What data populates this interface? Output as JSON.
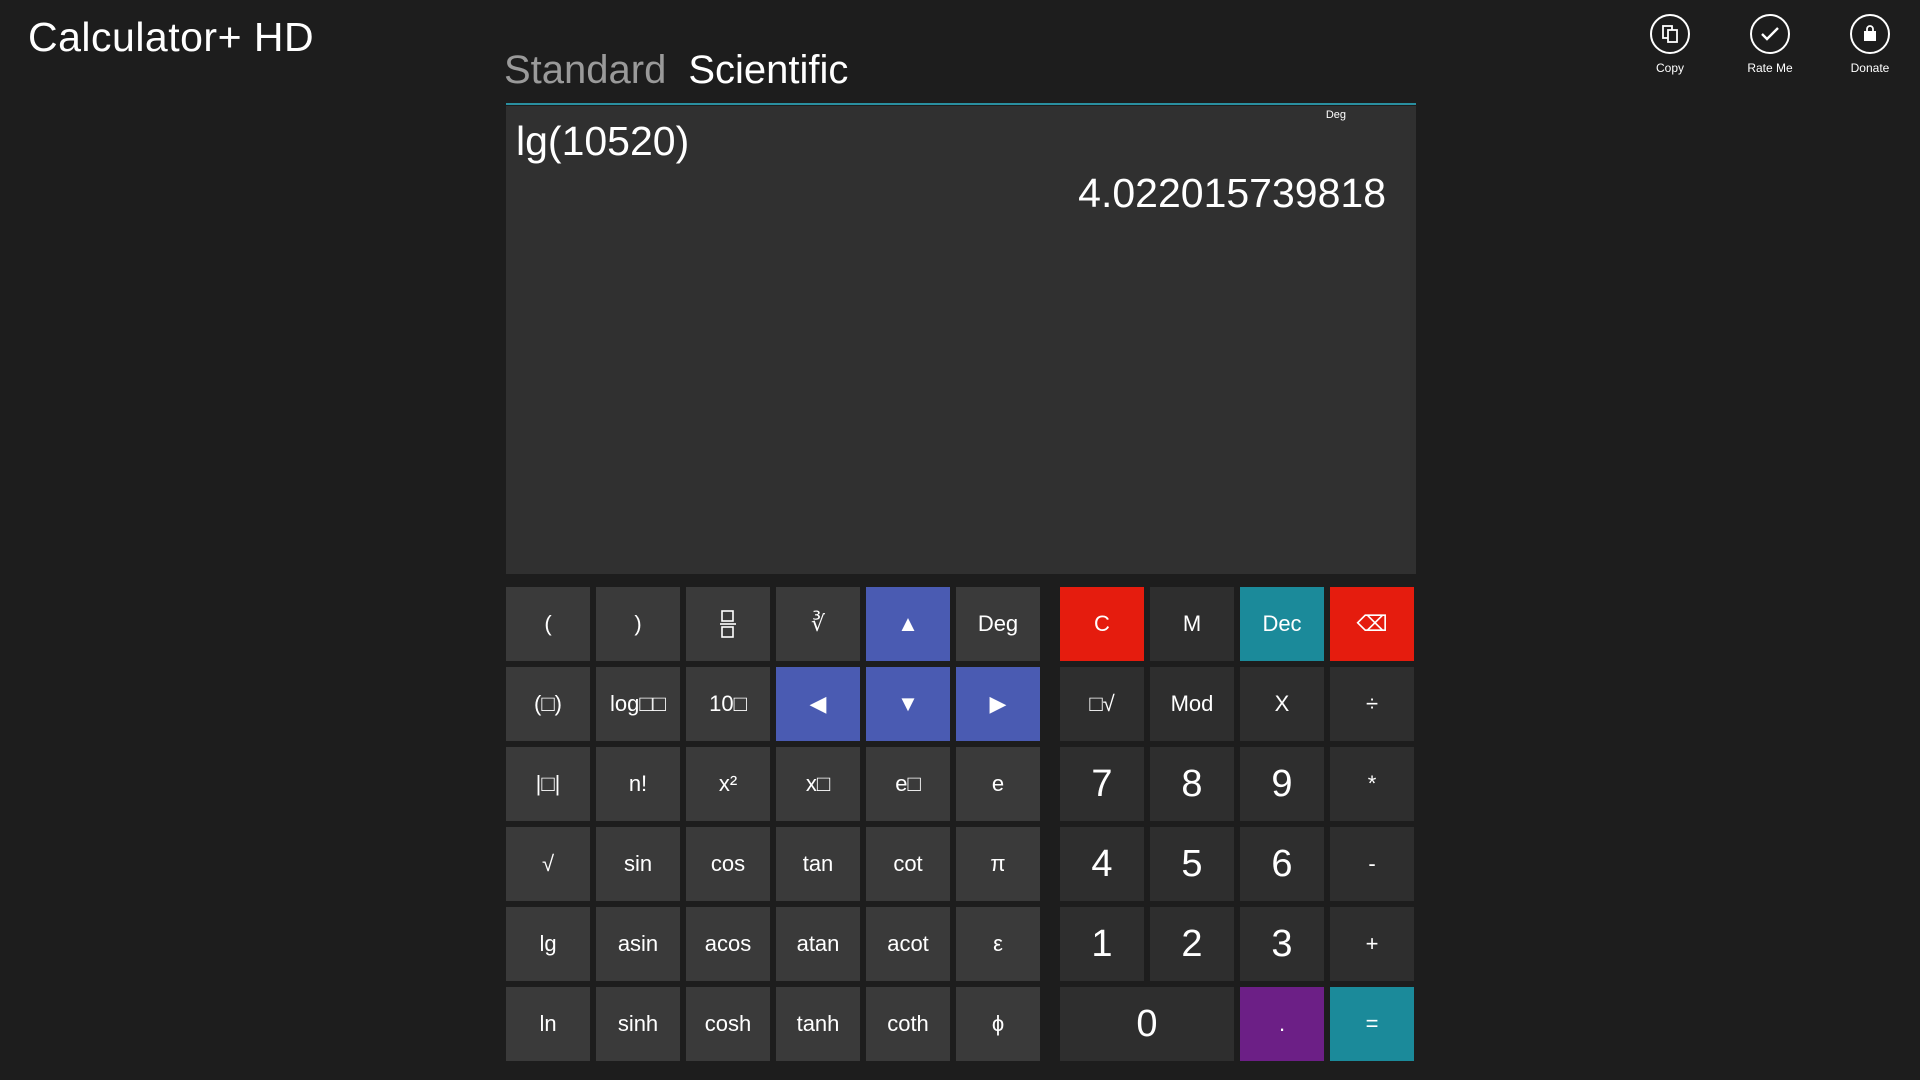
{
  "app": {
    "title": "Calculator+ HD"
  },
  "tabs": [
    {
      "label": "Standard",
      "active": false
    },
    {
      "label": "Scientific",
      "active": true
    }
  ],
  "appbar": {
    "copy_label": "Copy",
    "rate_label": "Rate Me",
    "donate_label": "Donate"
  },
  "display": {
    "angle_mode": "Deg",
    "expression": "lg(10520)",
    "result": "4.022015739818"
  },
  "keypad": {
    "scientific": {
      "row1": [
        "(",
        ")",
        "□/□",
        "∛",
        "▲",
        "Deg"
      ],
      "row2": [
        "(□)",
        "log□□",
        "10□",
        "◀",
        "▼",
        "▶"
      ],
      "row3": [
        "|□|",
        "n!",
        "x²",
        "x□",
        "e□",
        "e"
      ],
      "row4": [
        "√",
        "sin",
        "cos",
        "tan",
        "cot",
        "π"
      ],
      "row5": [
        "lg",
        "asin",
        "acos",
        "atan",
        "acot",
        "ε"
      ],
      "row6": [
        "ln",
        "sinh",
        "cosh",
        "tanh",
        "coth",
        "ϕ"
      ]
    },
    "standard": {
      "row1": [
        "C",
        "M",
        "Dec",
        "⌫"
      ],
      "row2": [
        "□√",
        "Mod",
        "X",
        "÷"
      ],
      "row3": [
        "7",
        "8",
        "9",
        "*"
      ],
      "row4": [
        "4",
        "5",
        "6",
        "-"
      ],
      "row5": [
        "1",
        "2",
        "3",
        "+"
      ],
      "row6": [
        "0",
        ".",
        "="
      ]
    }
  },
  "colors": {
    "background": "#1d1d1d",
    "display": "#303030",
    "key": "#3a3a3a",
    "key_dark": "#2e2e2e",
    "arrow_blue": "#4a5bb2",
    "clear_red": "#e51c0e",
    "accent_teal": "#1b8a9a",
    "dot_purple": "#6c1f86"
  }
}
